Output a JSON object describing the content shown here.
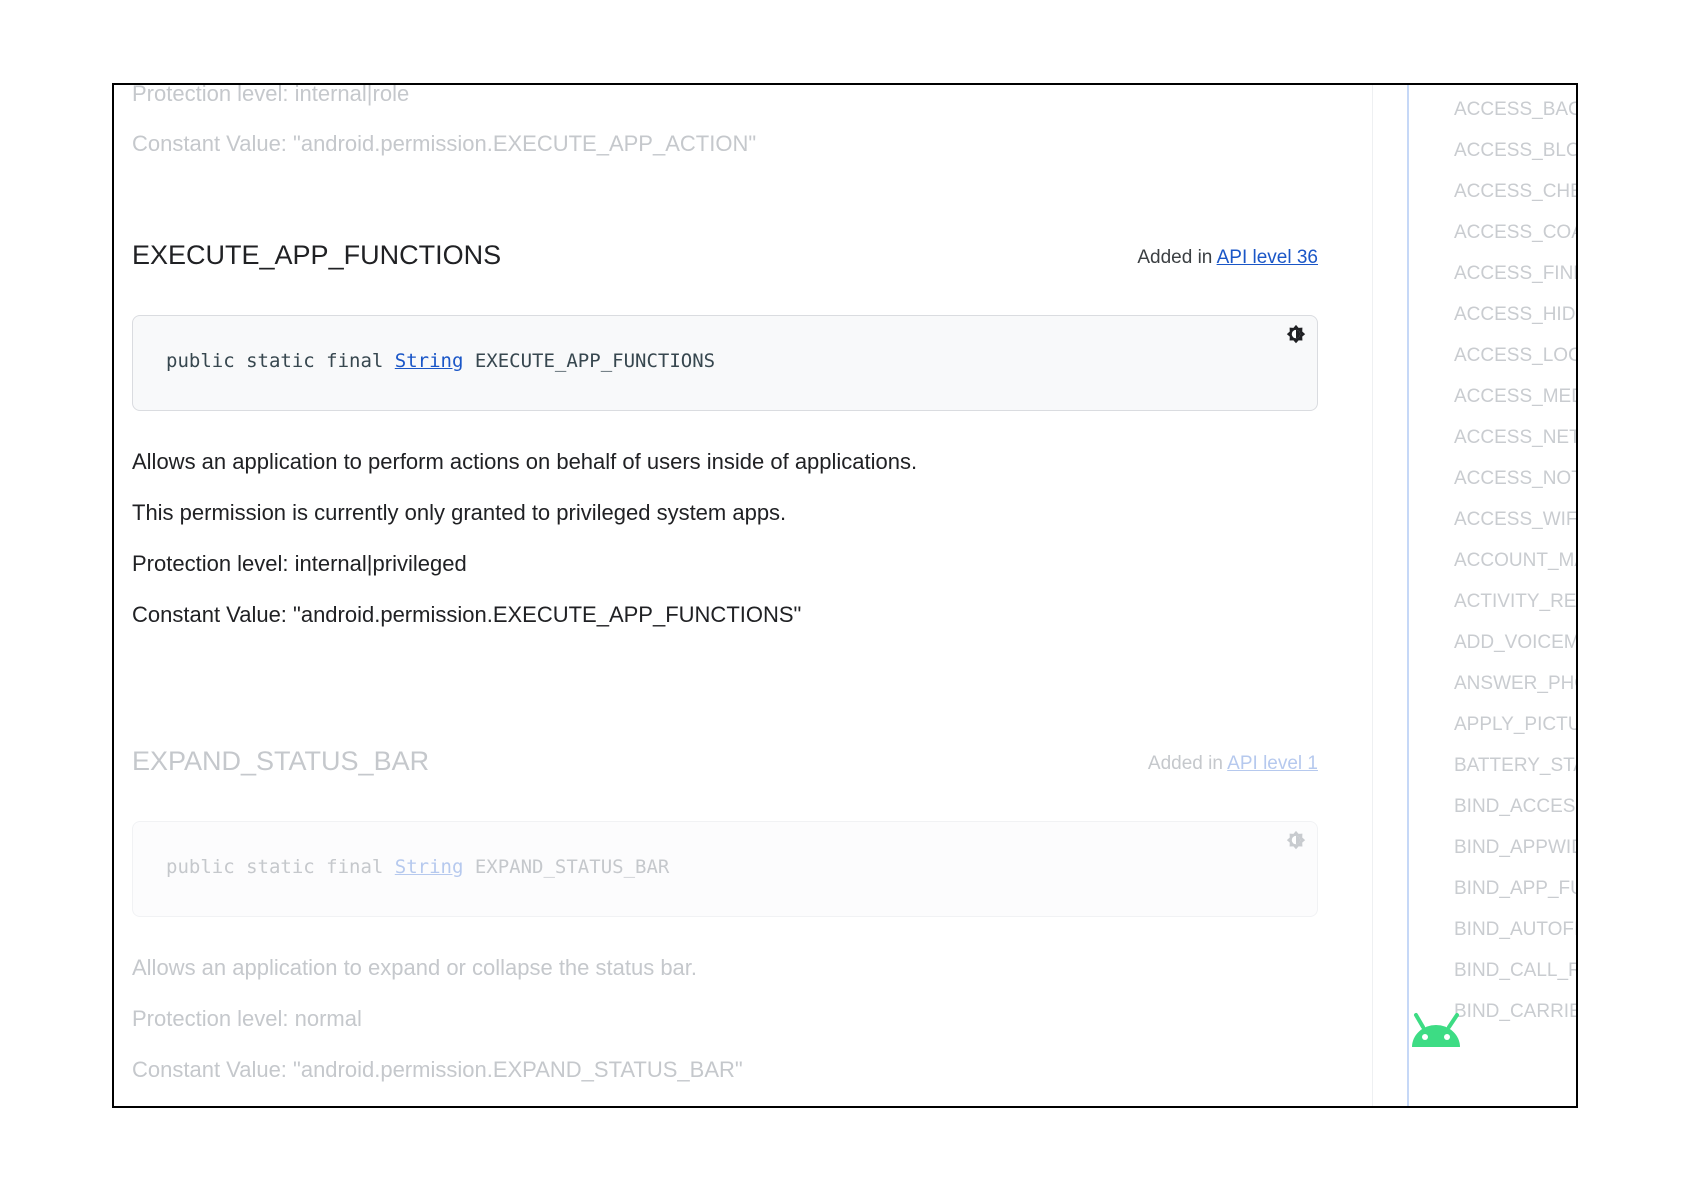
{
  "top_section": {
    "protection_level": "Protection level: internal|role",
    "constant_value": "Constant Value: \"android.permission.EXECUTE_APP_ACTION\""
  },
  "execute_section": {
    "title": "EXECUTE_APP_FUNCTIONS",
    "added_prefix": "Added in ",
    "api_link": "API level 36",
    "code_prefix": "public static final ",
    "code_type": "String",
    "code_suffix": " EXECUTE_APP_FUNCTIONS",
    "description": "Allows an application to perform actions on behalf of users inside of applications.",
    "note": "This permission is currently only granted to privileged system apps.",
    "protection_level": "Protection level: internal|privileged",
    "constant_value": "Constant Value: \"android.permission.EXECUTE_APP_FUNCTIONS\""
  },
  "expand_section": {
    "title": "EXPAND_STATUS_BAR",
    "added_prefix": "Added in ",
    "api_link": "API level 1",
    "code_prefix": "public static final ",
    "code_type": "String",
    "code_suffix": " EXPAND_STATUS_BAR",
    "description": "Allows an application to expand or collapse the status bar.",
    "protection_level": "Protection level: normal",
    "constant_value": "Constant Value: \"android.permission.EXPAND_STATUS_BAR\""
  },
  "toc": {
    "items": [
      "ACCESS_BACK",
      "ACCESS_BLOB",
      "ACCESS_CHEC",
      "ACCESS_COAR",
      "ACCESS_FINE",
      "ACCESS_HIDD",
      "ACCESS_LOCA",
      "ACCESS_MEDI",
      "ACCESS_NETW",
      "ACCESS_NOTI",
      "ACCESS_WIFI_",
      "ACCOUNT_MA",
      "ACTIVITY_REC",
      "ADD_VOICEMA",
      "ANSWER_PHO",
      "APPLY_PICTUR",
      "BATTERY_STAT",
      "BIND_ACCESSI",
      "BIND_APPWID",
      "BIND_APP_FUN",
      "BIND_AUTOFIL",
      "BIND_CALL_RE",
      "BIND_CARRIER"
    ]
  },
  "icons": {
    "theme_toggle": "brightness-icon",
    "mascot": "android-mascot-icon"
  },
  "colors": {
    "link": "#1a56c7",
    "mascot": "#3ddc84",
    "toc_rail": "#c6d8f7"
  }
}
